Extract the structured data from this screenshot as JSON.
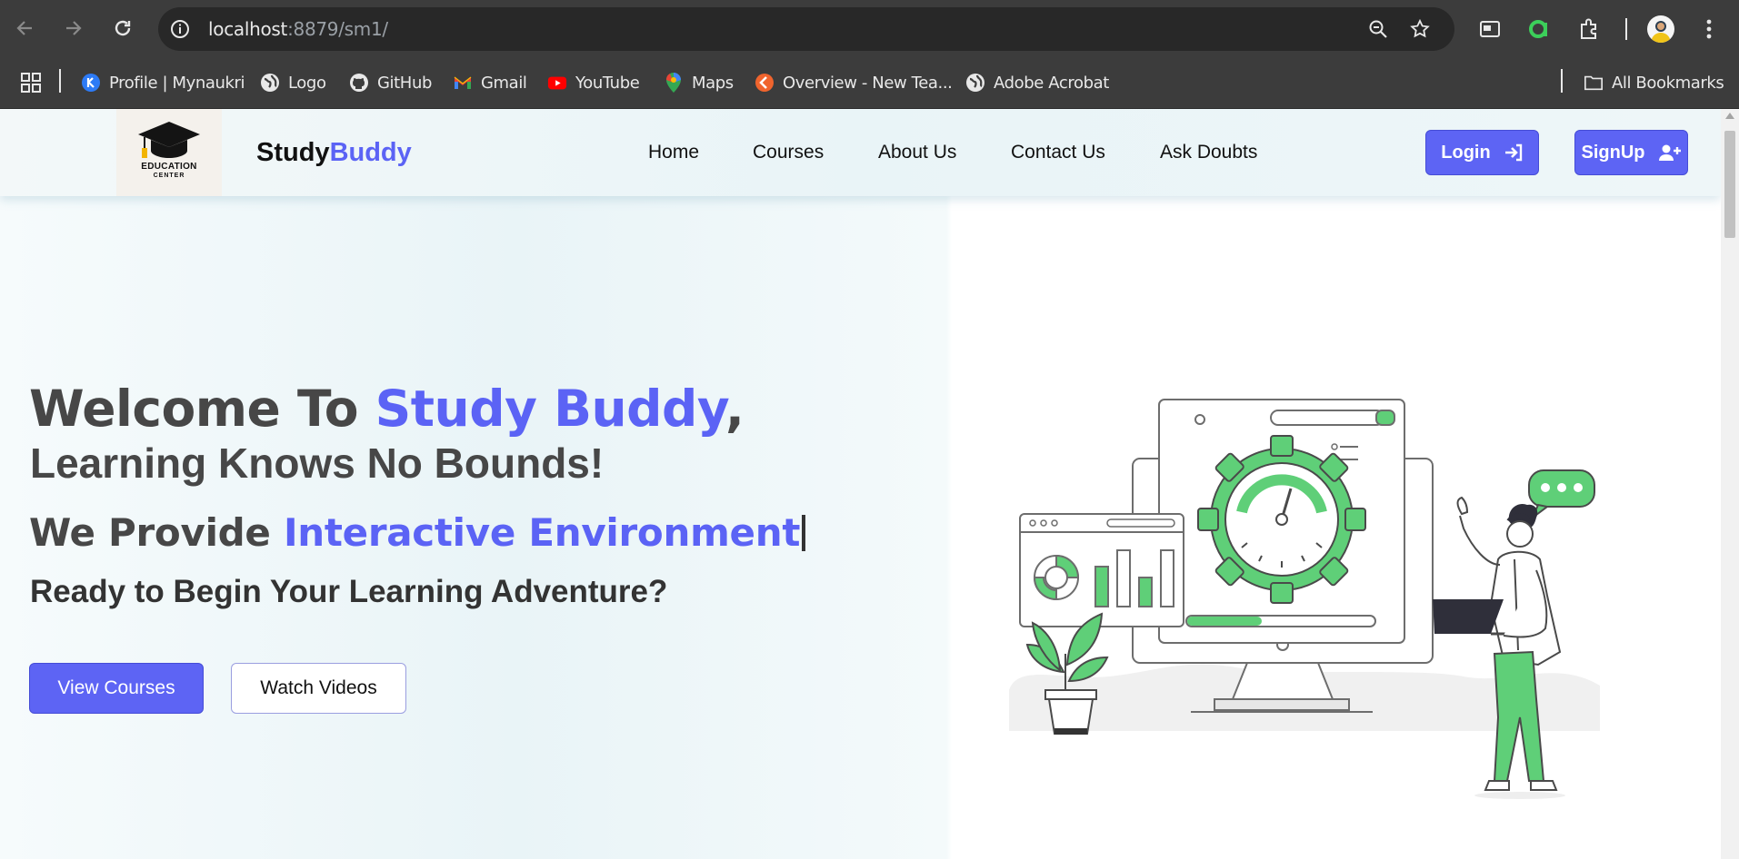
{
  "browser": {
    "url_host": "localhost",
    "url_rest": ":8879/sm1/",
    "bookmarks": [
      {
        "label": "Profile | Mynaukri",
        "icon": "mynaukri-icon"
      },
      {
        "label": "Logo",
        "icon": "globe-icon"
      },
      {
        "label": "GitHub",
        "icon": "github-icon"
      },
      {
        "label": "Gmail",
        "icon": "gmail-icon"
      },
      {
        "label": "YouTube",
        "icon": "youtube-icon"
      },
      {
        "label": "Maps",
        "icon": "maps-icon"
      },
      {
        "label": "Overview - New Tea...",
        "icon": "overview-icon"
      },
      {
        "label": "Adobe Acrobat",
        "icon": "globe-icon"
      }
    ],
    "all_bookmarks": "All Bookmarks"
  },
  "header": {
    "logo_line1": "EDUCATION",
    "logo_line2": "CENTER",
    "brand_part1": "Study",
    "brand_part2": "Buddy",
    "nav": [
      "Home",
      "Courses",
      "About Us",
      "Contact Us",
      "Ask Doubts"
    ],
    "login_label": "Login",
    "signup_label": "SignUp"
  },
  "hero": {
    "welcome_prefix": "Welcome To ",
    "welcome_accent": "Study Buddy",
    "welcome_suffix": ",",
    "tagline": "Learning Knows No Bounds!",
    "provide_prefix": "We Provide ",
    "provide_accent": "Interactive Environment",
    "ready": "Ready to Begin Your Learning Adventure?",
    "primary_button": "View Courses",
    "secondary_button": "Watch Videos"
  },
  "colors": {
    "accent": "#5b63f5",
    "illustration_green": "#5fcf78",
    "chrome_dark": "#3c3c3c"
  }
}
